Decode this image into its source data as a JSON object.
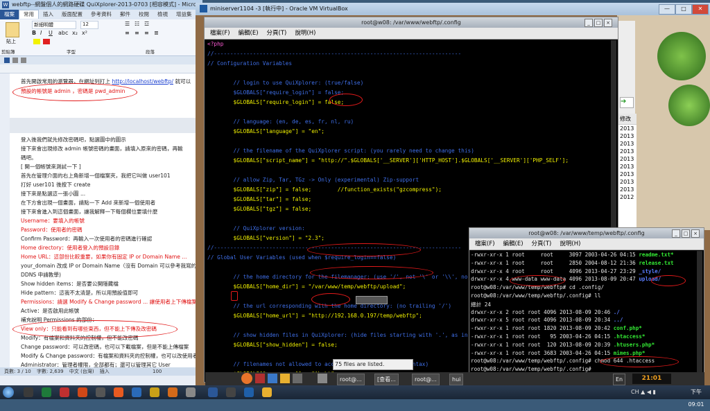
{
  "word": {
    "title": "webftp--網盤個人的網路硬碟 QuiXplorer-2013-0703 [相容模式] - Micro",
    "tabs": [
      "檔案",
      "常用",
      "插入",
      "版面配置",
      "參考資料",
      "郵件",
      "校閱",
      "檢視",
      "增益集"
    ],
    "font_name": "新細明體",
    "font_size": "12",
    "ribbon_groups": [
      "剪貼簿",
      "字型",
      "段落"
    ],
    "paste_label": "貼上",
    "lines": [
      {
        "text": "首先開啟常用的瀏覽器，在網址列打上 http://localhost/webftp/ 就可以",
        "style": "normal"
      },
      {
        "text": "預設的帳號是 admin ，密碼是 pwd_admin",
        "style": "red"
      },
      {
        "text": "登入後我們就先修改密碼吧，點選圖中的圖示",
        "style": "normal"
      },
      {
        "text": "接下來會出現修改 admin 帳號密碼的畫面，請填入原來的密碼，再輸",
        "style": "normal"
      },
      {
        "text": "碼吧。",
        "style": "normal"
      },
      {
        "text": "[ 開一個帳號來測試一下 ]",
        "style": "normal"
      },
      {
        "text": "首先在管理介面的右上角新增一個檔案夾，我把它叫做 user101",
        "style": "mixed"
      },
      {
        "text": "打好 user101 後按下 create",
        "style": "normal"
      },
      {
        "text": "接下來是點選這一張小圖 ...",
        "style": "normal"
      },
      {
        "text": "在下方會出現一個畫面，請點一下 Add 來新增一個使用者",
        "style": "normal"
      },
      {
        "text": "接下來會進入到這個畫面，讓我解釋一下每個欄位要填什麼",
        "style": "normal"
      },
      {
        "text": "Username：要填入的帳號",
        "style": "red"
      },
      {
        "text": "Password：使用者的密碼",
        "style": "red"
      },
      {
        "text": "Confirm Password：再輸入一次使用者的密碼進行確認",
        "style": "normal"
      },
      {
        "text": "Home directory：使用者登入的預設目錄",
        "style": "red"
      },
      {
        "text": "Home URL：這部份比較重要，如果你有固定 IP or Domain Name ...",
        "style": "mixed2"
      },
      {
        "text": "your_domain 改成 IP or Domain Name（沒有 Domain 可以參考我寫的",
        "style": "normal"
      },
      {
        "text": "DDNS 申請教學)",
        "style": "normal"
      },
      {
        "text": "Show hidden items：是否要公開隱藏檔",
        "style": "normal"
      },
      {
        "text": "Hide pattern：這我不太清楚，所以用預設值即可",
        "style": "normal"
      },
      {
        "text": "Permissions：請選 Modify & Change password ... 讓使用者上下傳檔案",
        "style": "mixed3"
      },
      {
        "text": "Active：是否啟用此帳號",
        "style": "normal"
      },
      {
        "text": "補充說明 Permissions 的部份：",
        "style": "normal"
      },
      {
        "text": "View only：只能看到有哪些東西，但不能上下傳及改密碼",
        "style": "red"
      },
      {
        "text": "Modify：有檔案和資料夾的控制權，但不能改密碼",
        "style": "normal"
      },
      {
        "text": "Change password：可以改密碼，也可以下載檔案，但是不能上傳檔案",
        "style": "normal"
      },
      {
        "text": "Modify & Change password：有檔案和資料夾的控制權，也可以改使用者",
        "style": "normal"
      },
      {
        "text": "Administrator：管理者權限，全部都有；還可以管理其它 User",
        "style": "normal"
      }
    ],
    "status": {
      "page": "頁數: 3 / 10",
      "words": "字數: 2,639",
      "lang": "中文 (台灣)",
      "mode": "插入",
      "zoom": "100"
    }
  },
  "vbox": {
    "title": "miniserver1104 -3 [執行中] - Oracle VM VirtualBox",
    "controls": [
      "—",
      "□",
      "✕"
    ]
  },
  "term1": {
    "title": "root@w08: /var/www/webftp/.config",
    "menu": [
      "檔案(F)",
      "編輯(E)",
      "分頁(T)",
      "說明(H)"
    ],
    "lines": [
      {
        "t": "<?php",
        "c": "k-pink"
      },
      {
        "t": "//----------------------------------------------------------------------------",
        "c": "k-blue"
      },
      {
        "t": "// Configuration Variables",
        "c": "k-blue"
      },
      {
        "t": "",
        "c": "k-blue"
      },
      {
        "t": "        // login to use QuiXplorer: (true/false)",
        "c": "k-blue"
      },
      {
        "t": "        $GLOBALS[\"require_login\"] = false;",
        "c": "k-blue"
      },
      {
        "t": "        $GLOBALS[\"require_login\"] = false;",
        "c": "k-yellow"
      },
      {
        "t": "",
        "c": "k-blue"
      },
      {
        "t": "        // language: (en, de, es, fr, nl, ru)",
        "c": "k-blue"
      },
      {
        "t": "        $GLOBALS[\"language\"] = \"en\";",
        "c": "k-yellow"
      },
      {
        "t": "",
        "c": "k-blue"
      },
      {
        "t": "        // the filename of the QuiXplorer script: (you rarely need to change this)",
        "c": "k-blue"
      },
      {
        "t": "        $GLOBALS[\"script_name\"] = \"http://\".$GLOBALS['__SERVER']['HTTP_HOST'].$GLOBALS['__SERVER']['PHP_SELF'];",
        "c": "k-yellow"
      },
      {
        "t": "",
        "c": "k-blue"
      },
      {
        "t": "        // allow Zip, Tar, TGz -> Only (experimental) Zip-support",
        "c": "k-blue"
      },
      {
        "t": "        $GLOBALS[\"zip\"] = false;        //function_exists(\"gzcompress\");",
        "c": "k-yellow"
      },
      {
        "t": "        $GLOBALS[\"tar\"] = false;",
        "c": "k-yellow"
      },
      {
        "t": "        $GLOBALS[\"tgz\"] = false;",
        "c": "k-yellow"
      },
      {
        "t": "",
        "c": "k-blue"
      },
      {
        "t": "        // QuiXplorer version:",
        "c": "k-blue"
      },
      {
        "t": "        $GLOBALS[\"version\"] = \"2.3\";",
        "c": "k-yellow"
      },
      {
        "t": "//----------------------------------------------------------------------------",
        "c": "k-blue"
      },
      {
        "t": "// Global User Variables (used when $require_login==false)",
        "c": "k-blue"
      },
      {
        "t": "",
        "c": "k-blue"
      },
      {
        "t": "        // the home directory for the filemanager: (use '/', not '\\' or '\\\\', no trailing '/')",
        "c": "k-blue"
      },
      {
        "t": "        $GLOBALS[\"home_dir\"] = \"/var/www/temp/webftp/upload\";",
        "c": "k-yellow"
      },
      {
        "t": "",
        "c": "k-blue"
      },
      {
        "t": "        // the url corresponding with the home directory: (no trailing '/')",
        "c": "k-blue"
      },
      {
        "t": "        $GLOBALS[\"home_url\"] = \"http://192.168.0.197/temp/webftp\";",
        "c": "k-yellow"
      },
      {
        "t": "",
        "c": "k-blue"
      },
      {
        "t": "        // show hidden files in QuiXplorer: (hide files starting with '.', as in Linux/UNIX)",
        "c": "k-blue"
      },
      {
        "t": "        $GLOBALS[\"show_hidden\"] = false;",
        "c": "k-yellow"
      },
      {
        "t": "",
        "c": "k-blue"
      },
      {
        "t": "        // filenames not allowed to access: (uses PCRE regex syntax)",
        "c": "k-blue"
      },
      {
        "t": "        $GLOBALS[\"no_access\"] = \"^\\.ht\";",
        "c": "k-yellow"
      }
    ]
  },
  "term2": {
    "title": "root@w08: /var/www/temp/webftp/.config",
    "menu": [
      "檔案(F)",
      "編輯(E)",
      "分頁(T)",
      "說明(H)"
    ],
    "lines": [
      {
        "p": "-rwxr-xr-x 1 root     root     3097 2003-04-26 04:15 ",
        "n": "readme.txt*",
        "c": "g"
      },
      {
        "p": "-rwxr-xr-x 1 root     root     2850 2004-08-12 21:36 ",
        "n": "release.txt",
        "c": "g"
      },
      {
        "p": "drwxr-xr-x 4 root     root     4096 2013-04-27 23:29 ",
        "n": "_style/",
        "c": "b"
      },
      {
        "p": "drwxr-xr-x 4 www-data www-data 4096 2013-08-09 20:47 ",
        "n": "upload/",
        "c": "b"
      },
      {
        "p": "root@w08:/var/www/temp/webftp# cd .config/",
        "n": "",
        "c": ""
      },
      {
        "p": "root@w08:/var/www/temp/webftp/.config# ll",
        "n": "",
        "c": ""
      },
      {
        "p": "總計 24",
        "n": "",
        "c": ""
      },
      {
        "p": "drwxr-xr-x 2 root root 4096 2013-08-09 20:46 ",
        "n": "./",
        "c": "b"
      },
      {
        "p": "drwxr-xr-x 5 root root 4096 2013-08-09 20:34 ",
        "n": "../",
        "c": "b"
      },
      {
        "p": "-rwxr-xr-x 1 root root 1820 2013-08-09 20:42 ",
        "n": "conf.php*",
        "c": "g"
      },
      {
        "p": "-rwxr-xr-x 1 root root   95 2003-04-26 04:15 ",
        "n": ".htaccess*",
        "c": "g"
      },
      {
        "p": "-rwxr-xr-x 1 root root  120 2013-08-09 20:39 ",
        "n": ".htusers.php*",
        "c": "g"
      },
      {
        "p": "-rwxr-xr-x 1 root root 3683 2003-04-26 04:15 ",
        "n": "mimes.php*",
        "c": "g"
      },
      {
        "p": "root@w08:/var/www/temp/webftp/.config# chmod 644 .htaccess",
        "n": "",
        "c": ""
      },
      {
        "p": "root@w08:/var/www/temp/webftp/.config# ",
        "n": "",
        "c": ""
      }
    ]
  },
  "filemanager": {
    "column_header": "修改",
    "years": [
      "2013",
      "2013",
      "2013",
      "2013",
      "2013",
      "2013",
      "2013",
      "2013",
      "2013",
      "2012"
    ],
    "files_listed": "75 files are listed."
  },
  "guestbar": {
    "tasks": [
      "root@...",
      "[查看...",
      "root@...",
      "hui"
    ],
    "lang": "En",
    "clock": "21:01"
  },
  "hostbar": {
    "lang": "CH ▲ ◀ ▮",
    "clock": "下午 09:01"
  },
  "colors": {
    "accent_red": "#e21a1a",
    "term_bg": "#000000",
    "host_taskbar": "#1a2636"
  }
}
